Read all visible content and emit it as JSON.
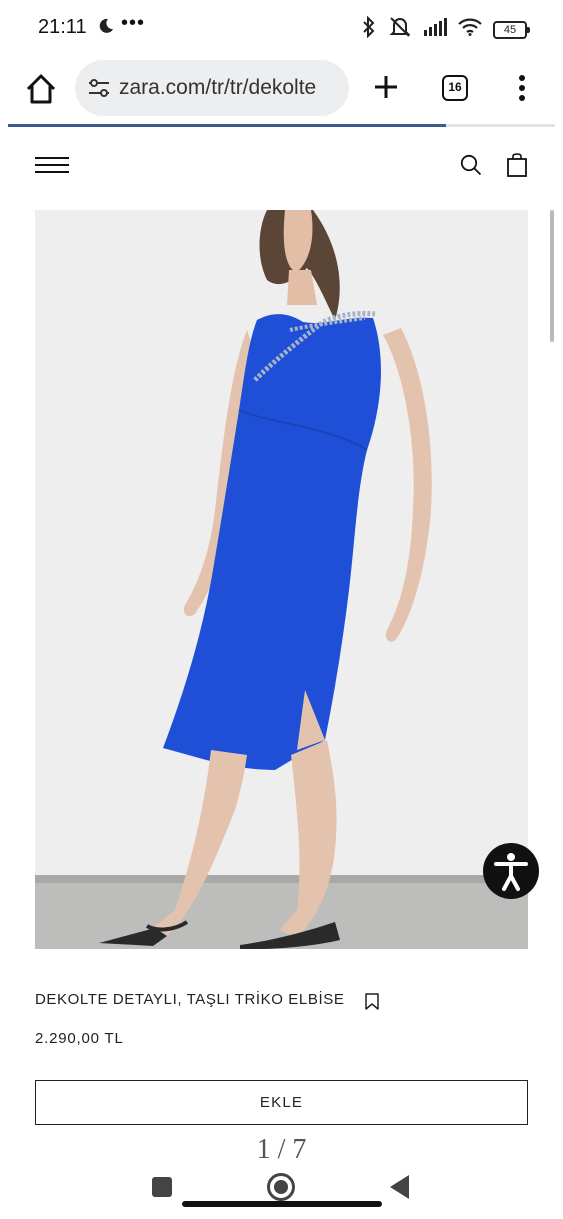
{
  "status_bar": {
    "time": "21:11",
    "overflow_indicator": "•••",
    "battery_level": "45",
    "icons": [
      "moon-icon",
      "bluetooth-icon",
      "silent-icon",
      "signal-icon",
      "wifi-icon",
      "battery-icon"
    ]
  },
  "browser": {
    "url": "zara.com/tr/tr/dekolte",
    "tab_count": "16",
    "page_load_progress": 0.8,
    "icons": [
      "home-icon",
      "site-settings-icon",
      "plus-icon",
      "tabs-icon",
      "more-vertical-icon"
    ]
  },
  "site_header": {
    "icons": [
      "hamburger-menu-icon",
      "search-icon",
      "shopping-bag-icon"
    ]
  },
  "product": {
    "title": "DEKOLTE DETAYLI, TAŞLI TRİKO ELBİSE",
    "price": "2.290,00 TL",
    "add_label": "EKLE",
    "image_pager": "1 / 7",
    "image_description_icon": "product-photo",
    "dress_color": "#1f4fd6"
  },
  "accessibility": {
    "icon": "accessibility-person-icon"
  },
  "nav_bar": {
    "icons": [
      "recents-icon",
      "home-circle-icon",
      "back-triangle-icon"
    ]
  },
  "colors": {
    "text": "#111111",
    "url_pill": "#eceef0",
    "progress": "#3b5b8e",
    "dress": "#1f4fd6",
    "backdrop": "#eeeeef"
  }
}
